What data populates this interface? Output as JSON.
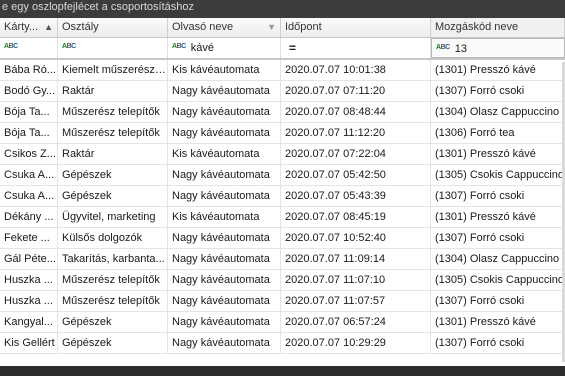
{
  "group_panel_text": "e egy oszlopfejlécet a csoportosításhoz",
  "columns": [
    {
      "label": "Kárty...",
      "sort": "▲"
    },
    {
      "label": "Osztály"
    },
    {
      "label": "Olvasó neve",
      "filter_icon": "funnel-icon"
    },
    {
      "label": "Időpont"
    },
    {
      "label": "Mozgáskód neve"
    }
  ],
  "filters": {
    "olvaso_neve": "kávé",
    "idopont": "=",
    "mozgaskod": "13"
  },
  "rows": [
    {
      "kartya": "Bába Ró...",
      "osztaly": "Kiemelt műszerész t...",
      "olvaso": "Kis kávéautomata",
      "idopont": "2020.07.07 10:01:38",
      "mozgaskod": "(1301) Presszó kávé"
    },
    {
      "kartya": "Bodó Gy...",
      "osztaly": "Raktár",
      "olvaso": "Nagy kávéautomata",
      "idopont": "2020.07.07 07:11:20",
      "mozgaskod": "(1307) Forró csoki"
    },
    {
      "kartya": "Bója Ta...",
      "osztaly": "Műszerész telepítők",
      "olvaso": "Nagy kávéautomata",
      "idopont": "2020.07.07 08:48:44",
      "mozgaskod": "(1304) Olasz Cappuccino"
    },
    {
      "kartya": "Bója Ta...",
      "osztaly": "Műszerész telepítők",
      "olvaso": "Nagy kávéautomata",
      "idopont": "2020.07.07 11:12:20",
      "mozgaskod": "(1306) Forró tea"
    },
    {
      "kartya": "Csikos Z...",
      "osztaly": "Raktár",
      "olvaso": "Kis kávéautomata",
      "idopont": "2020.07.07 07:22:04",
      "mozgaskod": "(1301) Presszó kávé"
    },
    {
      "kartya": "Csuka A...",
      "osztaly": "Gépészek",
      "olvaso": "Nagy kávéautomata",
      "idopont": "2020.07.07 05:42:50",
      "mozgaskod": "(1305) Csokis Cappuccino"
    },
    {
      "kartya": "Csuka A...",
      "osztaly": "Gépészek",
      "olvaso": "Nagy kávéautomata",
      "idopont": "2020.07.07 05:43:39",
      "mozgaskod": "(1307) Forró csoki"
    },
    {
      "kartya": "Dékány ...",
      "osztaly": "Ügyvitel, marketing",
      "olvaso": "Kis kávéautomata",
      "idopont": "2020.07.07 08:45:19",
      "mozgaskod": "(1301) Presszó kávé"
    },
    {
      "kartya": "Fekete ...",
      "osztaly": "Külsős dolgozók",
      "olvaso": "Nagy kávéautomata",
      "idopont": "2020.07.07 10:52:40",
      "mozgaskod": "(1307) Forró csoki"
    },
    {
      "kartya": "Gál Péte...",
      "osztaly": "Takarítás, karbanta...",
      "olvaso": "Nagy kávéautomata",
      "idopont": "2020.07.07 11:09:14",
      "mozgaskod": "(1304) Olasz Cappuccino"
    },
    {
      "kartya": "Huszka ...",
      "osztaly": "Műszerész telepítők",
      "olvaso": "Nagy kávéautomata",
      "idopont": "2020.07.07 11:07:10",
      "mozgaskod": "(1305) Csokis Cappuccino"
    },
    {
      "kartya": "Huszka ...",
      "osztaly": "Műszerész telepítők",
      "olvaso": "Nagy kávéautomata",
      "idopont": "2020.07.07 11:07:57",
      "mozgaskod": "(1307) Forró csoki"
    },
    {
      "kartya": "Kangyal...",
      "osztaly": "Gépészek",
      "olvaso": "Nagy kávéautomata",
      "idopont": "2020.07.07 06:57:24",
      "mozgaskod": "(1301) Presszó kávé"
    },
    {
      "kartya": "Kis Gellért",
      "osztaly": "Gépészek",
      "olvaso": "Nagy kávéautomata",
      "idopont": "2020.07.07 10:29:29",
      "mozgaskod": "(1307) Forró csoki"
    }
  ]
}
